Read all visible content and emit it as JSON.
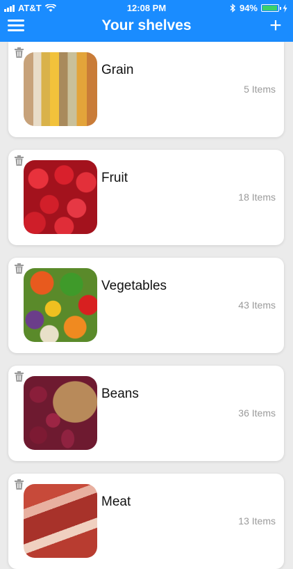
{
  "status_bar": {
    "carrier": "AT&T",
    "time": "12:08 PM",
    "battery": "94%",
    "battery_level": 0.94,
    "icons": [
      "signal-icon",
      "wifi-icon",
      "bluetooth-icon",
      "battery-icon",
      "charging-icon"
    ]
  },
  "header": {
    "title": "Your shelves",
    "menu_icon": "hamburger-menu-icon",
    "add_icon": "plus-icon",
    "color": "#1a8cff"
  },
  "shelves": [
    {
      "name": "Grain",
      "count": "5 Items",
      "image": "grain-image"
    },
    {
      "name": "Fruit",
      "count": "18 Items",
      "image": "strawberries-image"
    },
    {
      "name": "Vegetables",
      "count": "43 Items",
      "image": "vegetables-image"
    },
    {
      "name": "Beans",
      "count": "36 Items",
      "image": "beans-image"
    },
    {
      "name": "Meat",
      "count": "13 Items",
      "image": "meat-image"
    }
  ]
}
